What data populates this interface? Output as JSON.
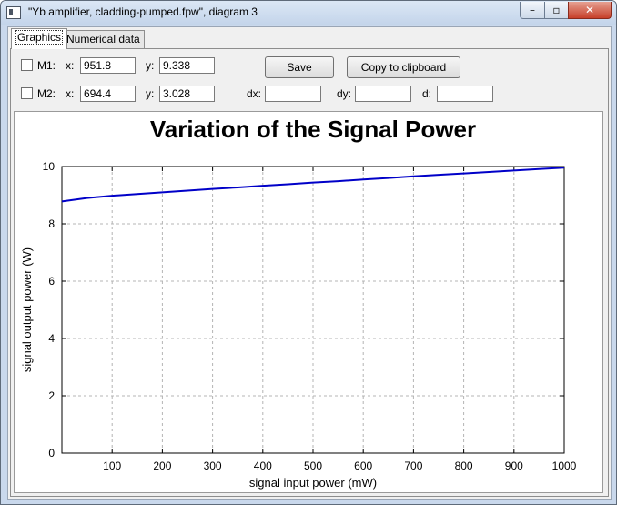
{
  "window": {
    "title": "\"Yb amplifier, cladding-pumped.fpw\", diagram 3",
    "minimize_glyph": "–",
    "maximize_glyph": "▫",
    "close_glyph": "✕"
  },
  "tabs": [
    {
      "label": "Graphics",
      "active": true
    },
    {
      "label": "Numerical data",
      "active": false
    }
  ],
  "markers": {
    "m1": {
      "label": "M1:",
      "x_label": "x:",
      "x_value": "951.8",
      "y_label": "y:",
      "y_value": "9.338",
      "checked": false
    },
    "m2": {
      "label": "M2:",
      "x_label": "x:",
      "x_value": "694.4",
      "y_label": "y:",
      "y_value": "3.028",
      "checked": false
    }
  },
  "deltas": {
    "dx_label": "dx:",
    "dx_value": "",
    "dy_label": "dy:",
    "dy_value": "",
    "d_label": "d:",
    "d_value": ""
  },
  "buttons": {
    "save": "Save",
    "copy": "Copy to clipboard"
  },
  "colors": {
    "curve": "#0000c8",
    "grid": "#b4b4b4"
  },
  "chart_data": {
    "type": "line",
    "title": "Variation of the Signal Power",
    "xlabel": "signal input power (mW)",
    "ylabel": "signal output power (W)",
    "xlim": [
      0,
      1000
    ],
    "ylim": [
      0,
      10
    ],
    "xticks": [
      100,
      200,
      300,
      400,
      500,
      600,
      700,
      800,
      900,
      1000
    ],
    "yticks": [
      0,
      2,
      4,
      6,
      8,
      10
    ],
    "grid": true,
    "series": [
      {
        "x": [
          0,
          50,
          100,
          150,
          200,
          250,
          300,
          350,
          400,
          450,
          500,
          550,
          600,
          650,
          700,
          750,
          800,
          850,
          900,
          950,
          1000
        ],
        "y": [
          8.78,
          8.9,
          8.98,
          9.04,
          9.1,
          9.16,
          9.22,
          9.27,
          9.33,
          9.38,
          9.44,
          9.49,
          9.55,
          9.6,
          9.66,
          9.71,
          9.76,
          9.81,
          9.86,
          9.91,
          9.96
        ]
      }
    ]
  }
}
